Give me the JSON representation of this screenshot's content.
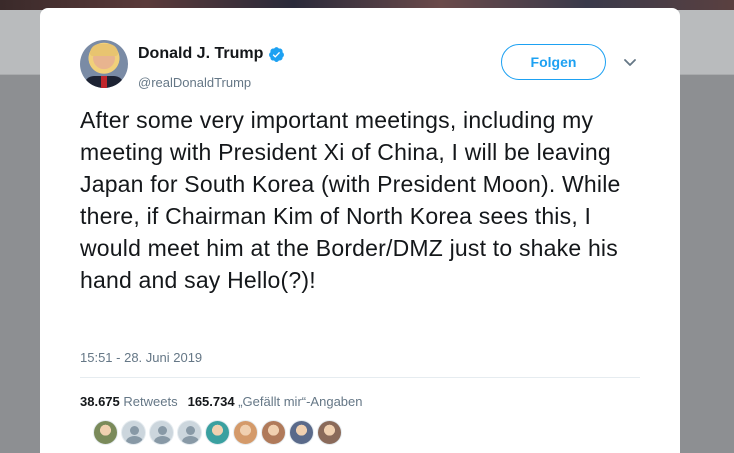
{
  "tweet": {
    "display_name": "Donald J. Trump",
    "handle": "@realDonaldTrump",
    "follow_label": "Folgen",
    "text": "After some very important meetings, including my meeting with President Xi of China, I will be leaving Japan for South Korea (with President Moon). While there, if Chairman Kim of North Korea sees this, I would meet him at the Border/DMZ just to shake his hand and say Hello(?)!",
    "timestamp": "15:51 - 28. Juni 2019",
    "retweets_count": "38.675",
    "retweets_label": "Retweets",
    "likes_count": "165.734",
    "likes_label": "„Gefällt mir“-Angaben"
  },
  "icons": {
    "verified": "verified-badge-icon",
    "more": "chevron-down-icon"
  },
  "facepile": [
    {
      "kind": "photo",
      "color": "#7a8a5a"
    },
    {
      "kind": "egg"
    },
    {
      "kind": "egg"
    },
    {
      "kind": "egg"
    },
    {
      "kind": "photo",
      "color": "#3aa0a0"
    },
    {
      "kind": "photo",
      "color": "#d49a6a"
    },
    {
      "kind": "photo",
      "color": "#b07a5a"
    },
    {
      "kind": "photo",
      "color": "#5a6a8a"
    },
    {
      "kind": "photo",
      "color": "#8a6a5a"
    }
  ],
  "colors": {
    "accent": "#1da1f2",
    "text_primary": "#14171a",
    "text_secondary": "#657786"
  }
}
